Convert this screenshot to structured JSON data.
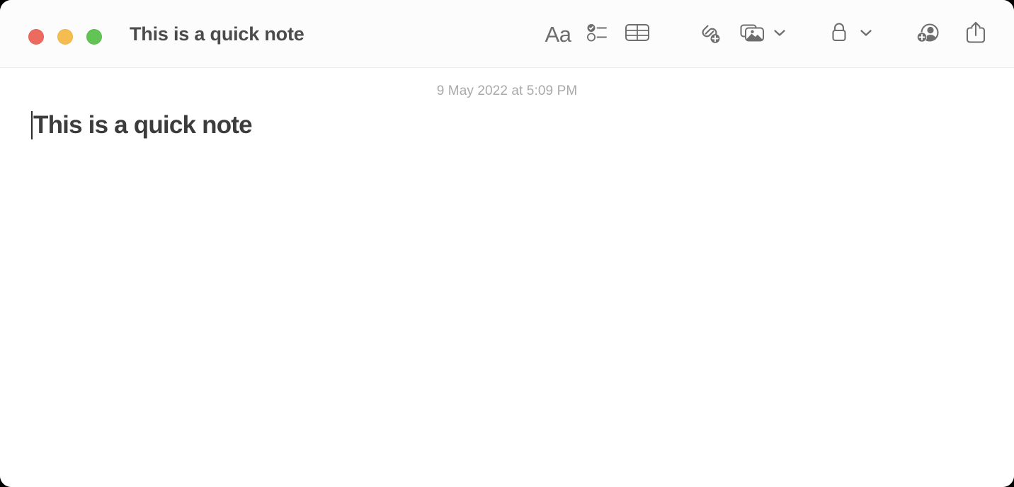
{
  "window": {
    "title": "This is a quick note",
    "traffic_lights": [
      {
        "name": "close",
        "color": "#ec6a5e"
      },
      {
        "name": "minimize",
        "color": "#f5bd4f"
      },
      {
        "name": "zoom",
        "color": "#61c454"
      }
    ]
  },
  "toolbar": {
    "format_label": "Aa",
    "buttons": [
      {
        "icon": "format-aa-icon",
        "label": "Aa"
      },
      {
        "icon": "checklist-icon",
        "label": "Checklist"
      },
      {
        "icon": "table-icon",
        "label": "Table"
      },
      {
        "icon": "link-add-icon",
        "label": "Add Link"
      },
      {
        "icon": "media-icon",
        "label": "Media"
      },
      {
        "icon": "lock-icon",
        "label": "Lock Note"
      },
      {
        "icon": "add-person-icon",
        "label": "Collaborate"
      },
      {
        "icon": "share-icon",
        "label": "Share"
      }
    ]
  },
  "note": {
    "date": "9 May 2022 at 5:09 PM",
    "title": "This is a quick note",
    "body": ""
  },
  "colors": {
    "toolbar_bg": "#fcfcfc",
    "body_bg": "#ffffff",
    "icon": "#6e6e6e",
    "title_text": "#4b4b4b",
    "date_text": "#a9a9a9",
    "note_title_text": "#3c3c3c"
  }
}
